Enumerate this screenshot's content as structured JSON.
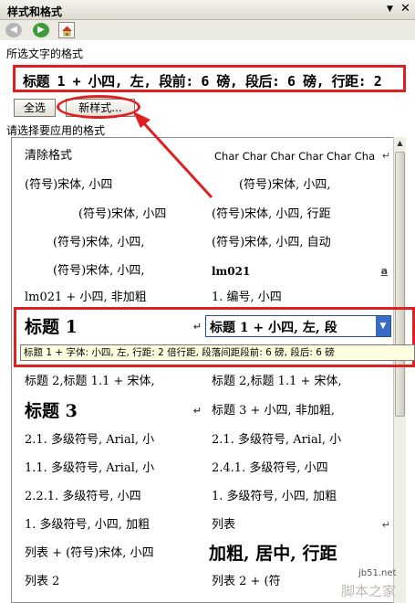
{
  "window": {
    "title": "样式和格式",
    "dropdown_glyph": "▼",
    "close_glyph": "✕"
  },
  "nav": {
    "back_glyph": "◀",
    "forward_glyph": "▶"
  },
  "current_section_label": "所选文字的格式",
  "current_style": "标题 1 + 小四, 左, 段前: 6 磅, 段后: 6 磅, 行距: 2",
  "buttons": {
    "select_all": "全选",
    "new_style": "新样式..."
  },
  "apply_section_label": "请选择要应用的格式",
  "left_column": [
    "清除格式",
    "(符号)宋体, 小四",
    "(符号)宋体, 小四",
    "(符号)宋体, 小四,",
    "(符号)宋体, 小四,",
    "lm021 + 小四, 非加粗",
    "标题 1",
    "标题 2,标题 1.1 + 宋体,",
    "标题 3",
    "2.1. 多级符号, Arial, 小",
    "1.1. 多级符号, Arial, 小",
    "2.2.1.  多级符号, 小四",
    "1.  多级符号, 小四, 加粗",
    "列表 + (符号)宋体, 小四",
    "列表 2"
  ],
  "right_column": [
    "Char Char Char Char Char Cha",
    "(符号)宋体, 小四,",
    "(符号)宋体, 小四, 行距",
    "(符号)宋体, 小四, 自动",
    "lm021",
    "1.  编号, 小四",
    "标题 1 + 小四, 左, 段",
    "标题 2,标题 1.1 + 宋体,",
    "标题 3 + 小四, 非加粗,",
    "2.1. 多级符号, Arial, 小",
    "2.4.1.  多级符号, 小四",
    "1.  多级符号, 小四, 加粗",
    "列表",
    "加粗, 居中, 行距",
    "列表 2 + (符"
  ],
  "tooltip": "标题 1 + 字体: 小四, 左, 行距: 2 倍行距, 段落间距段前: 6 磅, 段后: 6 磅",
  "return_mark": "↵",
  "char_mark": "a",
  "watermark": {
    "domain": "jb51.net",
    "name": "脚本之家"
  },
  "colors": {
    "highlight": "#e02020",
    "selection": "#3b6cc5"
  }
}
